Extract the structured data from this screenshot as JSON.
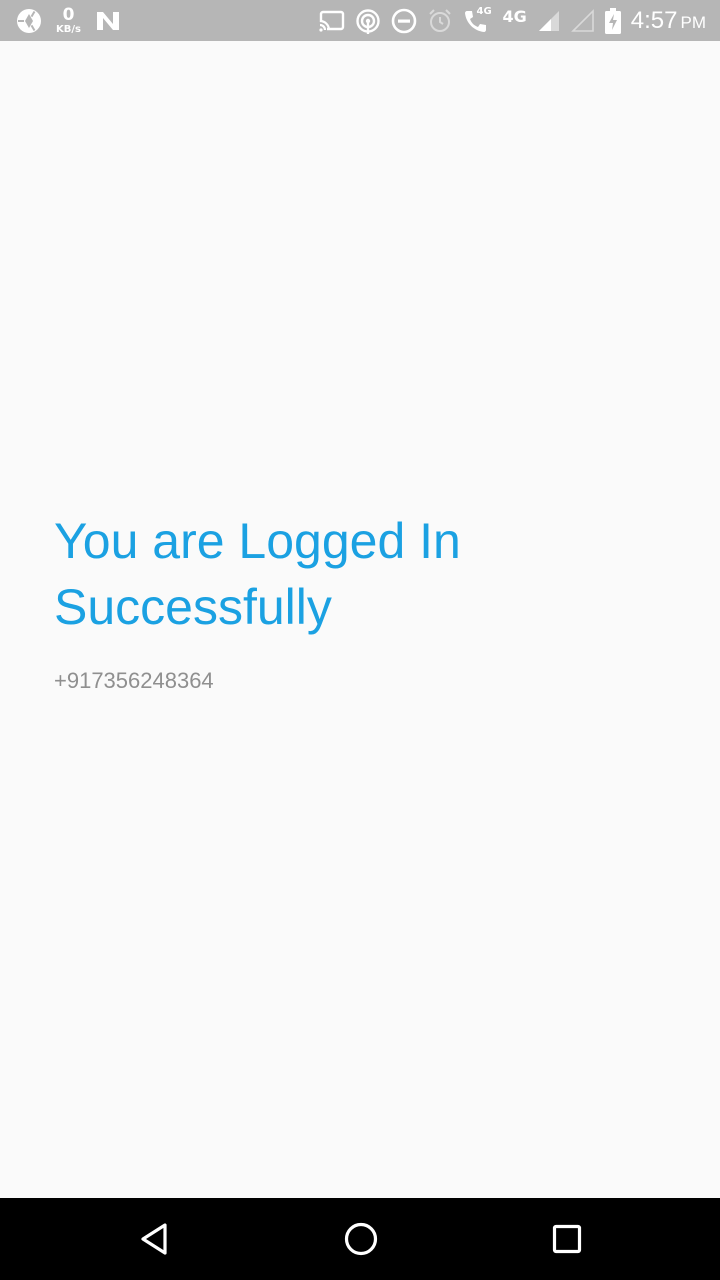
{
  "status_bar": {
    "net_speed_value": "0",
    "net_speed_unit": "KB/s",
    "network_label_small": "4G",
    "network_label": "4G",
    "time": "4:57",
    "ampm": "PM",
    "icons": [
      "shutter-icon",
      "n-icon",
      "cast-icon",
      "hotspot-icon",
      "dnd-icon",
      "alarm-icon",
      "volte-call-icon",
      "signal-icon",
      "signal-empty-icon",
      "battery-charging-icon"
    ]
  },
  "main": {
    "title": "You are Logged In Successfully",
    "phone_number": "+917356248364"
  },
  "colors": {
    "accent": "#1ba1e2",
    "secondary_text": "#8f8f8f",
    "background": "#fafafa",
    "status_bar": "#b6b6b6",
    "nav_bar": "#000000"
  }
}
